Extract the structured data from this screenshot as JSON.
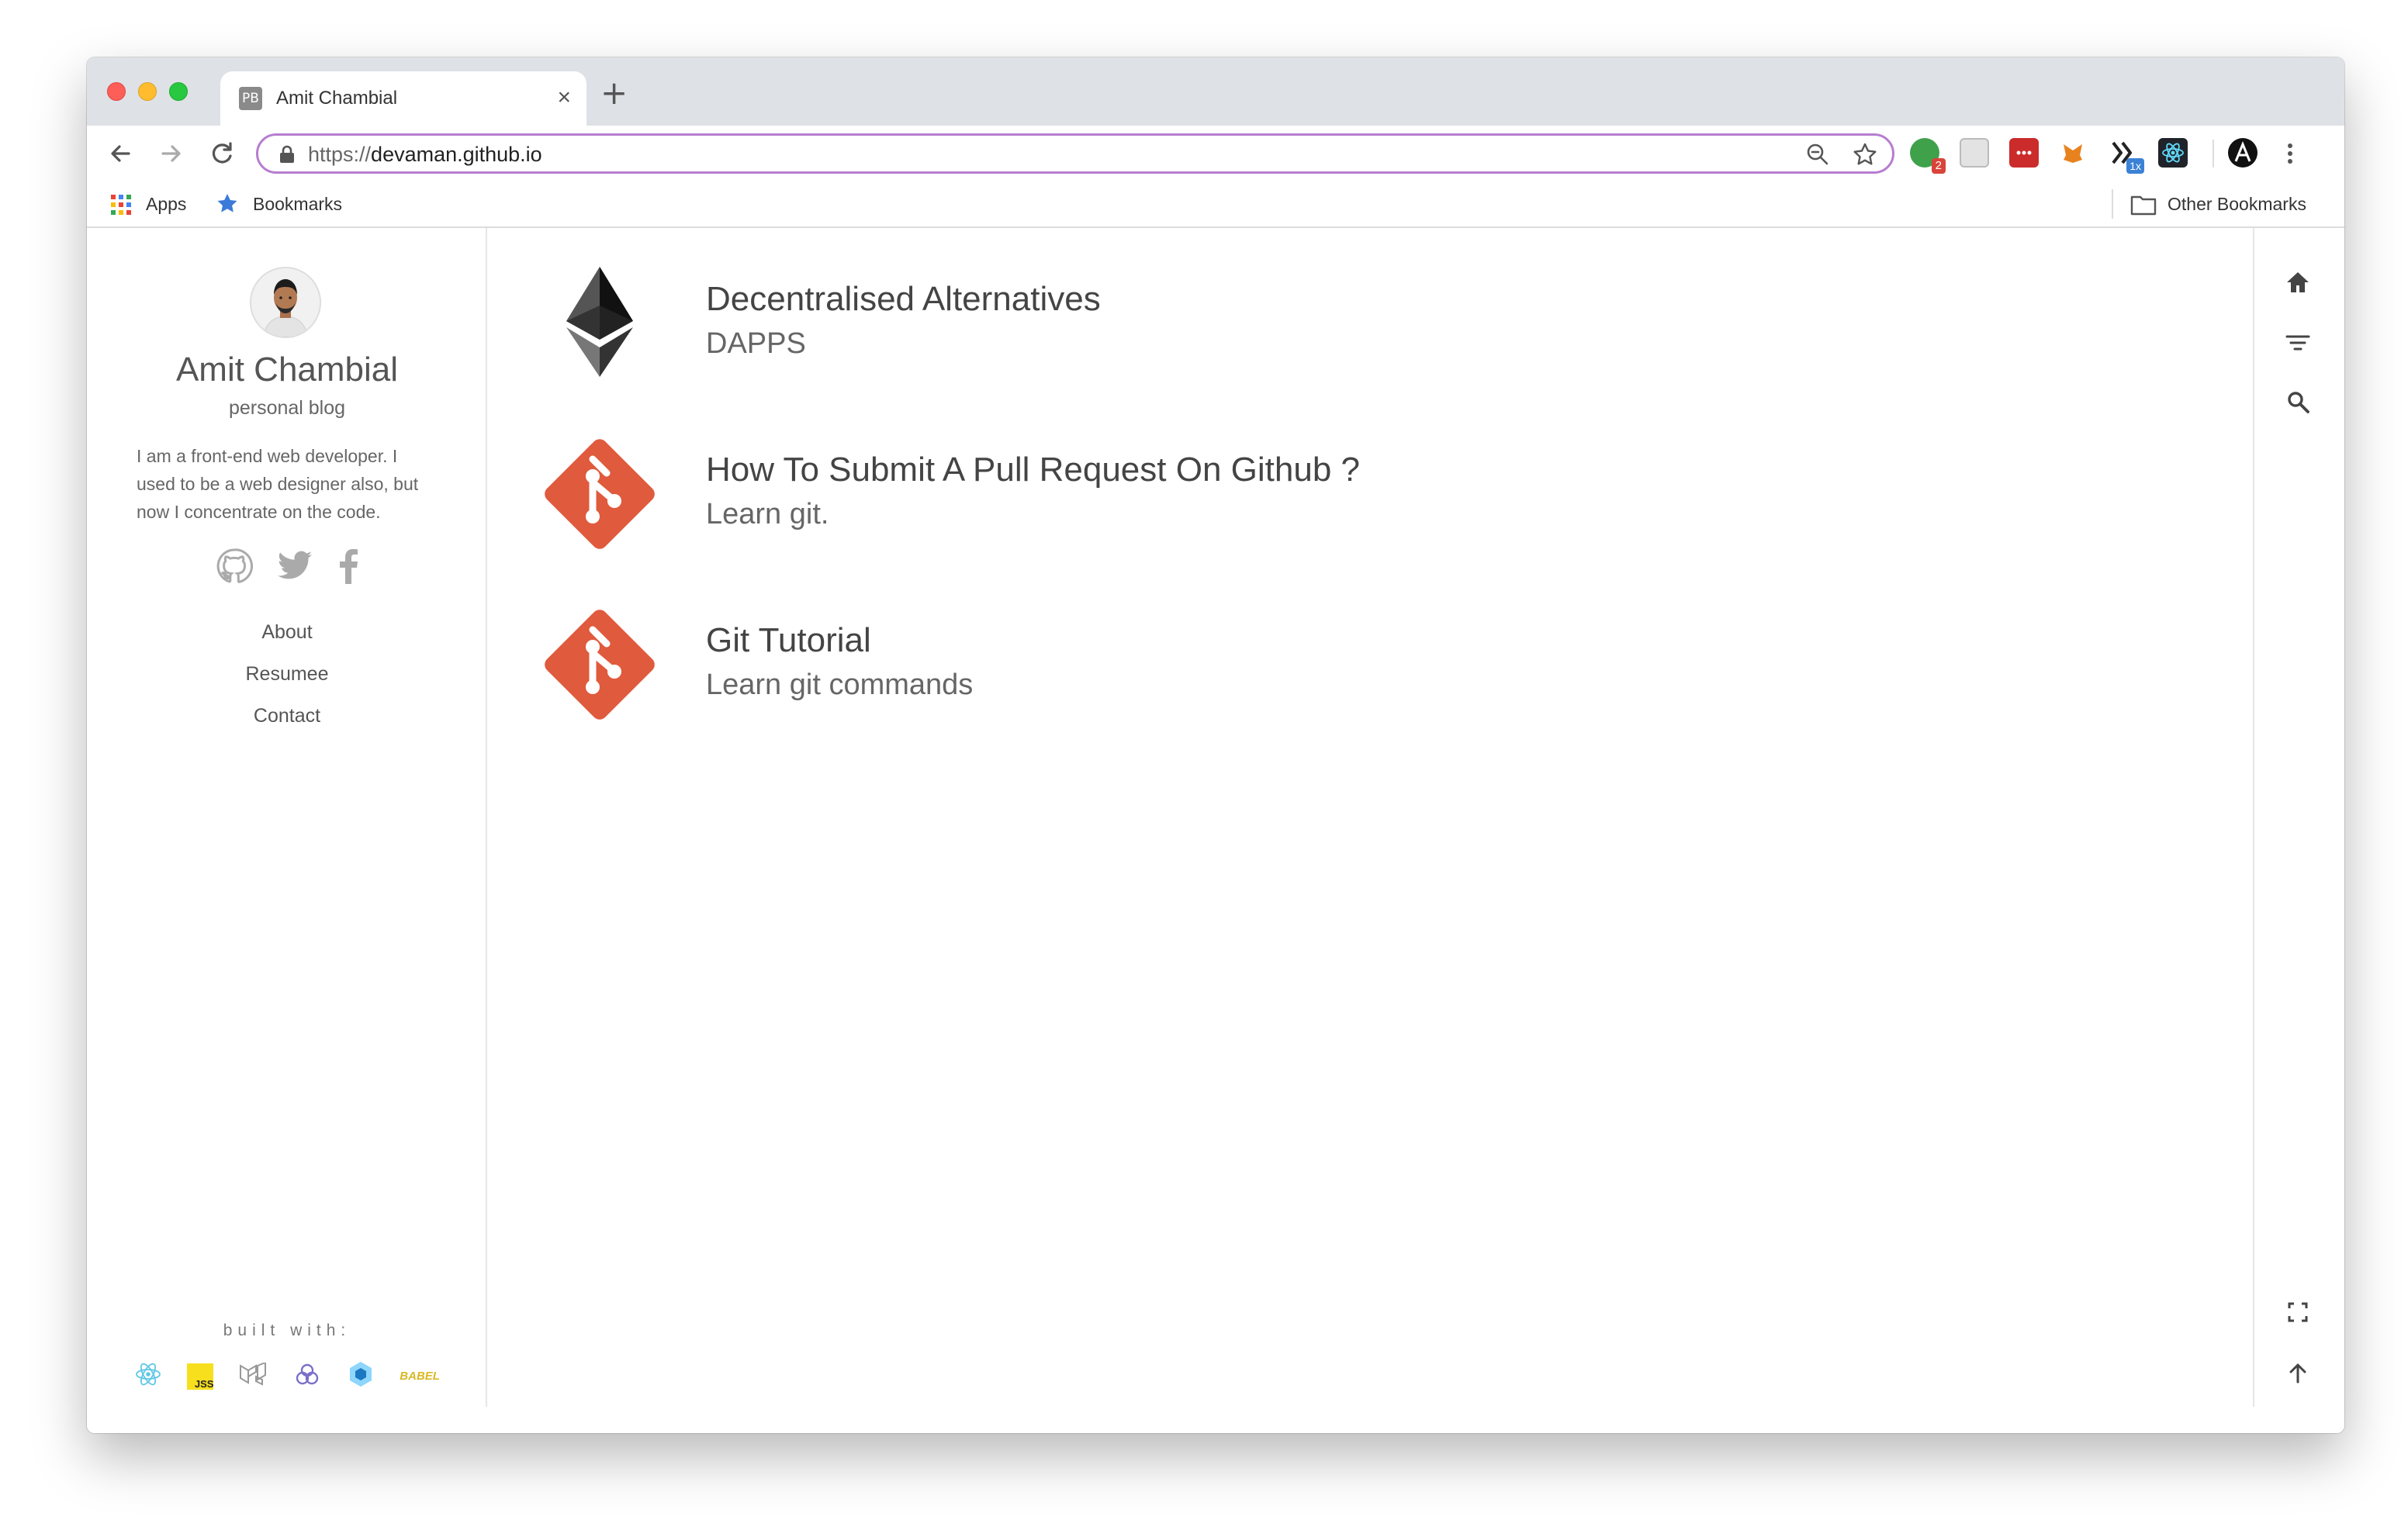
{
  "browser": {
    "tab_title": "Amit Chambial",
    "tab_favicon": "PB",
    "url_scheme": "https://",
    "url_host": "devaman.github.io",
    "extension_badges": {
      "ext1": "2",
      "ext6": "1x"
    },
    "bookmarks": {
      "apps_label": "Apps",
      "bookmarks_label": "Bookmarks",
      "other_label": "Other Bookmarks"
    }
  },
  "sidebar": {
    "name": "Amit Chambial",
    "subtitle": "personal blog",
    "bio": "I am a front-end web developer. I used to be a web designer also, but now I concentrate on the code.",
    "socials": [
      "github-icon",
      "twitter-icon",
      "facebook-icon"
    ],
    "nav": [
      "About",
      "Resumee",
      "Contact"
    ],
    "built_with_label": "built with:",
    "tech_icons": [
      "react-icon",
      "jss-icon",
      "material-ui-icon",
      "apollo-icon",
      "webpack-icon",
      "babel-icon"
    ],
    "jss_text": "JSS",
    "babel_text": "BABEL"
  },
  "posts": [
    {
      "title": "Decentralised Alternatives",
      "subtitle": "DAPPS",
      "icon": "ethereum-icon"
    },
    {
      "title": "How To Submit A Pull Request On Github ?",
      "subtitle": "Learn git.",
      "icon": "git-icon"
    },
    {
      "title": "Git Tutorial",
      "subtitle": "Learn git commands",
      "icon": "git-icon"
    }
  ],
  "right_toolbar": [
    "home-icon",
    "filter-icon",
    "search-icon",
    "fullscreen-icon",
    "arrow-up-icon"
  ],
  "colors": {
    "omnibox_border": "#b77dd0",
    "git_orange": "#e05a3d",
    "window_bg": "#ffffff",
    "tabstrip": "#dee1e6"
  }
}
